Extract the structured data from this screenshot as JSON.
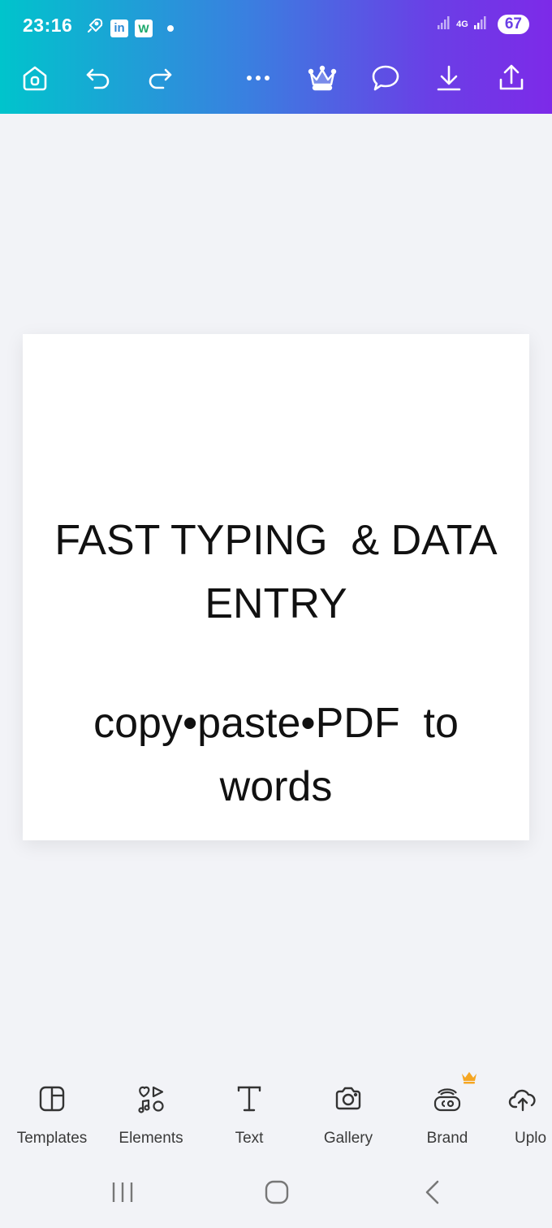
{
  "status_bar": {
    "time": "23:16",
    "linkedin_badge": "in",
    "w_badge": "W",
    "network": "4G",
    "battery": "67"
  },
  "toolbar": {
    "icons": [
      "home-icon",
      "undo-icon",
      "redo-icon",
      "more-icon",
      "crown-icon",
      "comment-icon",
      "download-icon",
      "share-icon"
    ]
  },
  "canvas": {
    "heading_line1": "FAST TYPING  & DATA",
    "heading_line2": "ENTRY",
    "sub_line1": "copy•paste•PDF  to",
    "sub_line2": "words"
  },
  "bottom_nav": {
    "items": [
      {
        "label": "Templates"
      },
      {
        "label": "Elements"
      },
      {
        "label": "Text"
      },
      {
        "label": "Gallery"
      },
      {
        "label": "Brand"
      },
      {
        "label": "Uplo"
      }
    ]
  },
  "colors": {
    "gradient_start": "#00c4cc",
    "gradient_end": "#7d2ae8",
    "crown_gold": "#f5a623"
  }
}
